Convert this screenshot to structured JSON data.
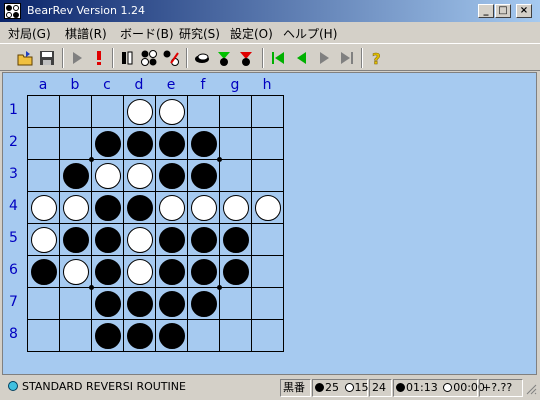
{
  "window": {
    "title": "BearRev Version 1.24"
  },
  "menu": [
    "対局(G)",
    "棋譜(R)",
    "ボード(B)",
    "研究(S)",
    "設定(O)",
    "ヘルプ(H)"
  ],
  "toolbar": {
    "icons": [
      "open-icon",
      "save-icon",
      "play-icon",
      "stop-red-icon",
      "disc-pair-icon",
      "board-random-icon",
      "board-edit-icon",
      "pass-black-icon",
      "arrow-down-green-icon",
      "arrow-down-red-icon",
      "first-move-icon",
      "prev-move-icon",
      "next-move-icon",
      "last-move-icon",
      "help-icon"
    ]
  },
  "board": {
    "columns": [
      "a",
      "b",
      "c",
      "d",
      "e",
      "f",
      "g",
      "h"
    ],
    "rows": [
      "1",
      "2",
      "3",
      "4",
      "5",
      "6",
      "7",
      "8"
    ],
    "cells": [
      "...WW...",
      "..BBBB..",
      ".BWWBB..",
      "WWBBWWWW",
      "WBBWBBB.",
      "BWBWBBB.",
      "..BBBB..",
      "..BBB..."
    ]
  },
  "status": {
    "routine": "STANDARD REVERSI ROUTINE",
    "turn": "黒番",
    "black_count": "25",
    "white_count": "15",
    "move_number": "24",
    "black_time": "01:13",
    "white_time": "00:00",
    "eval": "+?.??"
  },
  "colors": {
    "board": "#a6caf0",
    "label": "#0000c0",
    "title_start": "#0a246a",
    "title_end": "#a6caf0"
  }
}
